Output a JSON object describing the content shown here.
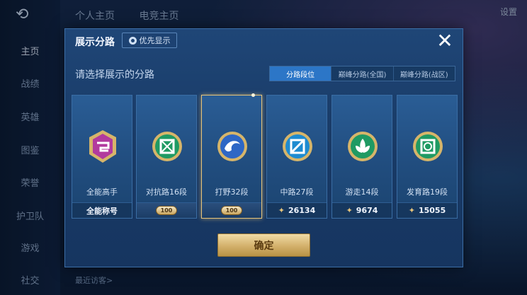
{
  "background": {
    "top_tabs": [
      "个人主页",
      "电竞主页"
    ],
    "top_right": "设置",
    "visitor_text": "最近访客>",
    "nav": [
      "主页",
      "战绩",
      "英雄",
      "图鉴",
      "荣誉",
      "护卫队",
      "游戏",
      "社交"
    ]
  },
  "modal": {
    "title": "展示分路",
    "priority_button": "优先显示",
    "close_glyph": "✕",
    "subtitle": "请选择展示的分路",
    "tabs": [
      {
        "label": "分路段位",
        "active": true
      },
      {
        "label": "巅峰分路(全国)",
        "active": false
      },
      {
        "label": "巅峰分路(战区)",
        "active": false
      }
    ],
    "cards": [
      {
        "label": "全能高手",
        "foot": "全能称号",
        "badge": "",
        "emblem_color": "#b23a9e",
        "icon": "mosaic-emblem-icon"
      },
      {
        "label": "对抗路16段",
        "foot": "",
        "badge": "100",
        "emblem_color": "#1f9a63",
        "icon": "cross-box-emblem-icon"
      },
      {
        "label": "打野32段",
        "foot": "",
        "badge": "100",
        "emblem_color": "#2e67c5",
        "icon": "swirl-emblem-icon",
        "selected": true
      },
      {
        "label": "中路27段",
        "foot": "26134",
        "badge": "",
        "emblem_color": "#1e8bd0",
        "icon": "slash-emblem-icon"
      },
      {
        "label": "游走14段",
        "foot": "9674",
        "badge": "",
        "emblem_color": "#1f9a63",
        "icon": "leaf-emblem-icon"
      },
      {
        "label": "发育路19段",
        "foot": "15055",
        "badge": "",
        "emblem_color": "#1f9a63",
        "icon": "ring-emblem-icon"
      }
    ],
    "confirm": "确定"
  }
}
